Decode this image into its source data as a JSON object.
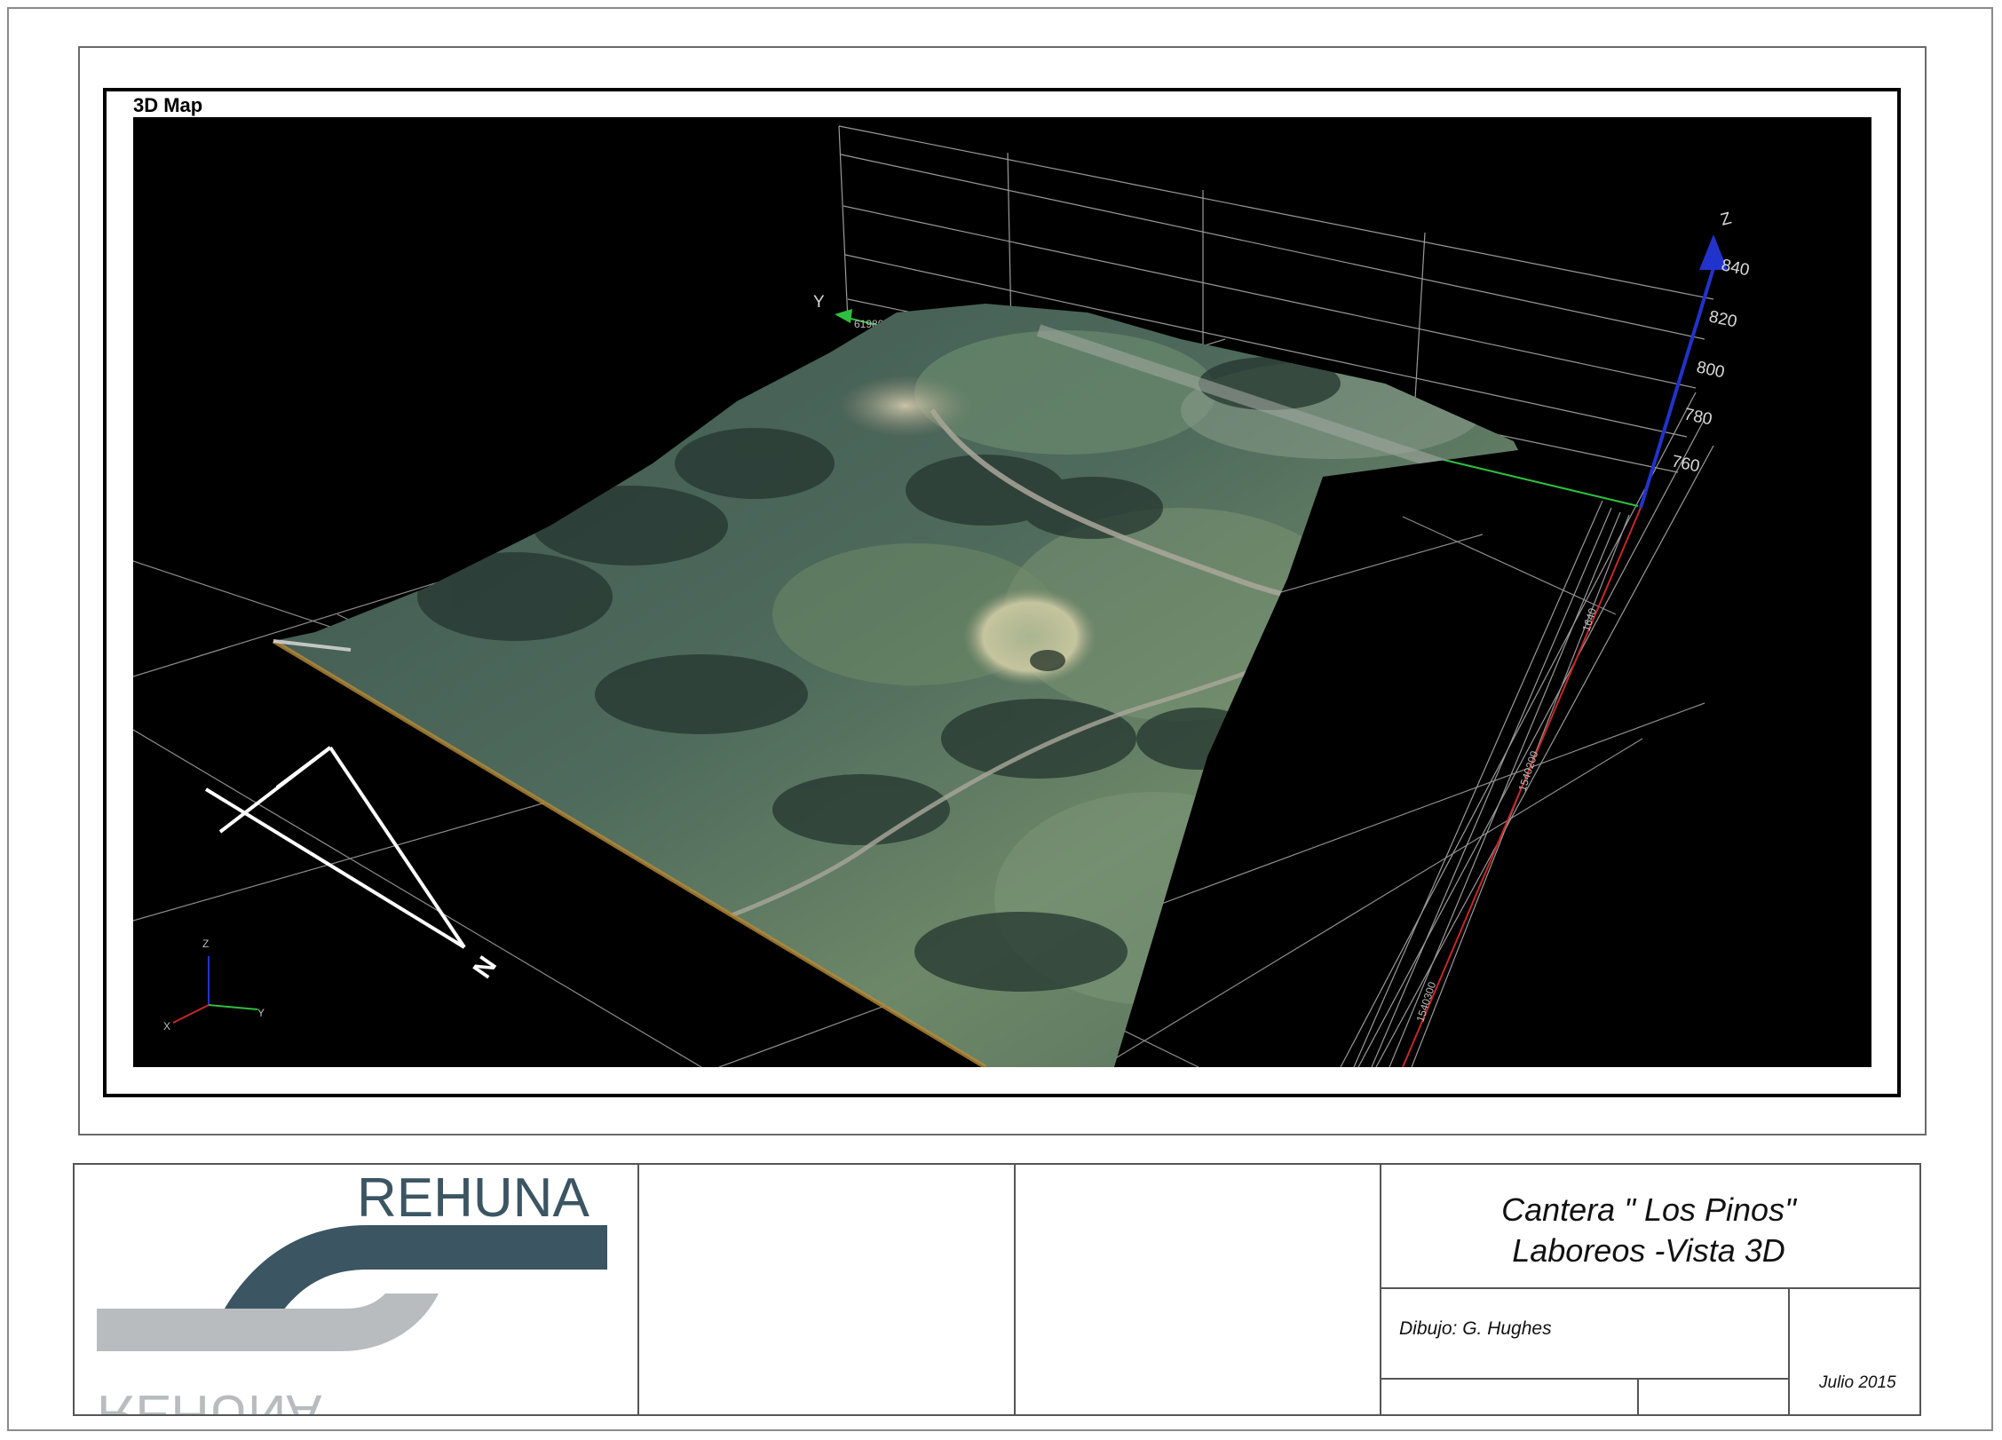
{
  "map": {
    "panel_label": "3D Map",
    "y_axis_name": "Y",
    "z_axis_name": "Z",
    "y_tick_label": "6198900",
    "z_ticks": [
      "840",
      "820",
      "800",
      "780",
      "760"
    ],
    "x_tick_labels": [
      "1640",
      "1540200",
      "1540300"
    ],
    "north_label": "N",
    "triad": {
      "x": "X",
      "y": "Y",
      "z": "Z"
    },
    "colors": {
      "background": "#000000",
      "grid": "#9a9a9a",
      "y_axis": "#2fbf3f",
      "z_axis": "#2233cc",
      "x_axis": "#c62828",
      "terrain_forest": "#3f5a52",
      "terrain_grass": "#6f8a6a",
      "terrain_edge": "#b58a3a"
    }
  },
  "title_block": {
    "logo_text": "REHUNA",
    "logo_text_mirrored": "REHUNA",
    "project_title_line1": "Cantera \" Los Pinos\"",
    "project_title_line2": "Laboreos -Vista 3D",
    "drawn_by": "Dibujo: G. Hughes",
    "date": "Julio 2015",
    "colors": {
      "logo_dark": "#3b5563",
      "logo_light": "#b9bcbf"
    }
  }
}
